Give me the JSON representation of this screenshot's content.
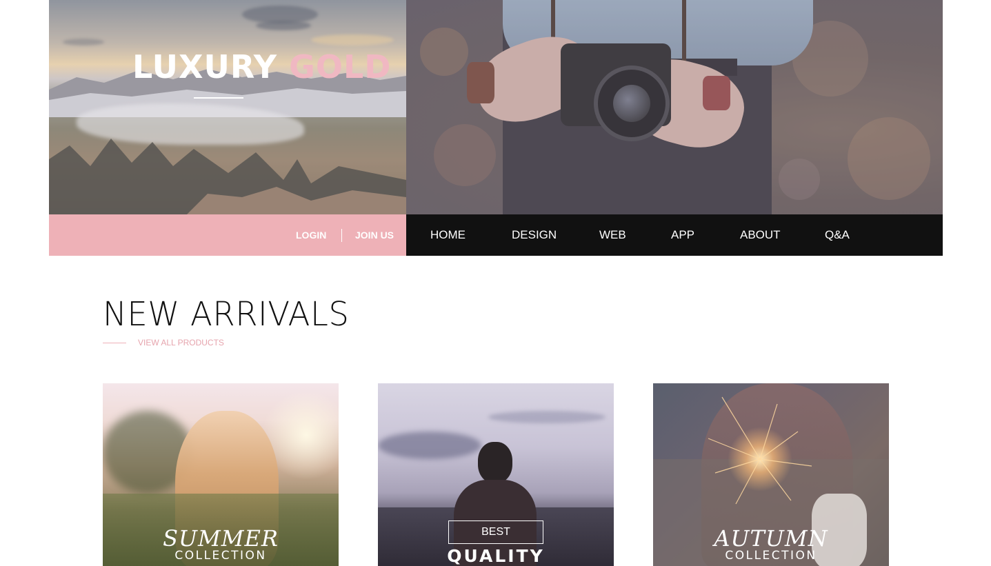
{
  "logo": {
    "word1": "LUXURY",
    "word2": "GOLD"
  },
  "account": {
    "login": "LOGIN",
    "join": "JOIN US"
  },
  "nav": {
    "items": [
      "HOME",
      "DESIGN",
      "WEB",
      "APP",
      "ABOUT",
      "Q&A"
    ]
  },
  "section": {
    "title": "NEW ARRIVALS",
    "view_all": "VIEW ALL PRODUCTS"
  },
  "cards": [
    {
      "script": "SUMMER",
      "sub": "COLLECTION"
    },
    {
      "box": "BEST",
      "sub": "QUALITY"
    },
    {
      "script": "AUTUMN",
      "sub": "COLLECTION"
    }
  ],
  "colors": {
    "accent_pink": "#eeb1b7",
    "nav_dark": "#111111"
  }
}
